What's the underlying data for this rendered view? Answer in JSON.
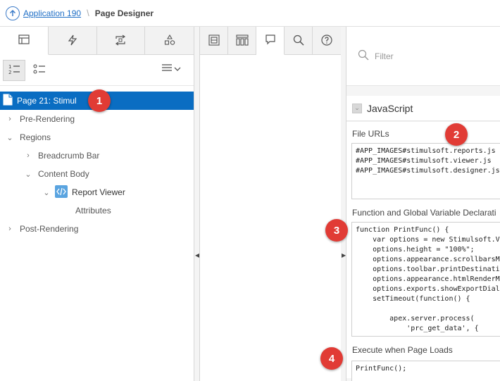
{
  "header": {
    "app_link": "Application 190",
    "separator": "\\",
    "title": "Page Designer"
  },
  "left_panel": {
    "tabs": [
      {
        "name": "rendering-tab",
        "icon": "tree-list-icon",
        "active": true
      },
      {
        "name": "dynamic-actions-tab",
        "icon": "lightning-icon",
        "active": false
      },
      {
        "name": "processing-tab",
        "icon": "arrows-loop-icon",
        "active": false
      },
      {
        "name": "shared-components-tab",
        "icon": "shapes-icon",
        "active": false
      }
    ],
    "tree": {
      "page": "Page 21: Stimul",
      "pre_rendering": "Pre-Rendering",
      "regions": "Regions",
      "breadcrumb_bar": "Breadcrumb Bar",
      "content_body": "Content Body",
      "report_viewer": "Report Viewer",
      "attributes": "Attributes",
      "post_rendering": "Post-Rendering"
    }
  },
  "right_panel": {
    "filter_placeholder": "Filter",
    "section_title": "JavaScript",
    "file_urls_label": "File URLs",
    "file_urls": "#APP_IMAGES#stimulsoft.reports.js\n#APP_IMAGES#stimulsoft.viewer.js\n#APP_IMAGES#stimulsoft.designer.js",
    "function_label": "Function and Global Variable Declarati",
    "function_code": "function PrintFunc() {\n    var options = new Stimulsoft.Vi\n    options.height = \"100%\";\n    options.appearance.scrollbarsMo\n    options.toolbar.printDestinatio\n    options.appearance.htmlRenderMo\n    options.exports.showExportDialo\n    setTimeout(function() {\n\n        apex.server.process(\n            'prc_get_data', {",
    "execute_label": "Execute when Page Loads",
    "execute_code": "PrintFunc();"
  },
  "badges": [
    "1",
    "2",
    "3",
    "4"
  ],
  "colors": {
    "selection": "#0a6dc2",
    "badge": "#e13b35",
    "link": "#1f6fc6"
  }
}
